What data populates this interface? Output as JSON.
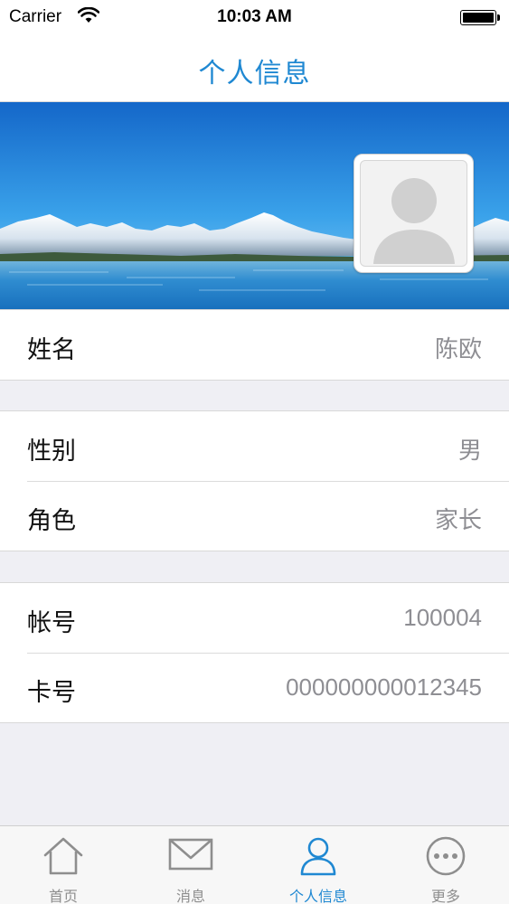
{
  "status_bar": {
    "carrier": "Carrier",
    "time": "10:03 AM",
    "wifi_icon": "wifi-icon",
    "battery_icon": "battery-icon"
  },
  "nav": {
    "title": "个人信息"
  },
  "profile": {
    "banner_image": "mountain-lake-landscape",
    "avatar_icon": "default-avatar-icon"
  },
  "sections": [
    {
      "rows": [
        {
          "label": "姓名",
          "value": "陈欧"
        }
      ]
    },
    {
      "rows": [
        {
          "label": "性别",
          "value": "男"
        },
        {
          "label": "角色",
          "value": "家长"
        }
      ]
    },
    {
      "rows": [
        {
          "label": "帐号",
          "value": "100004"
        },
        {
          "label": "卡号",
          "value": "000000000012345"
        }
      ]
    }
  ],
  "tabs": [
    {
      "label": "首页",
      "icon": "home-icon",
      "active": false
    },
    {
      "label": "消息",
      "icon": "mail-icon",
      "active": false
    },
    {
      "label": "个人信息",
      "icon": "person-icon",
      "active": true
    },
    {
      "label": "更多",
      "icon": "more-icon",
      "active": false
    }
  ],
  "colors": {
    "accent": "#1f88d2",
    "value_text": "#8e8e93",
    "background": "#efeff4",
    "inactive_tab": "#8e8e8e"
  }
}
